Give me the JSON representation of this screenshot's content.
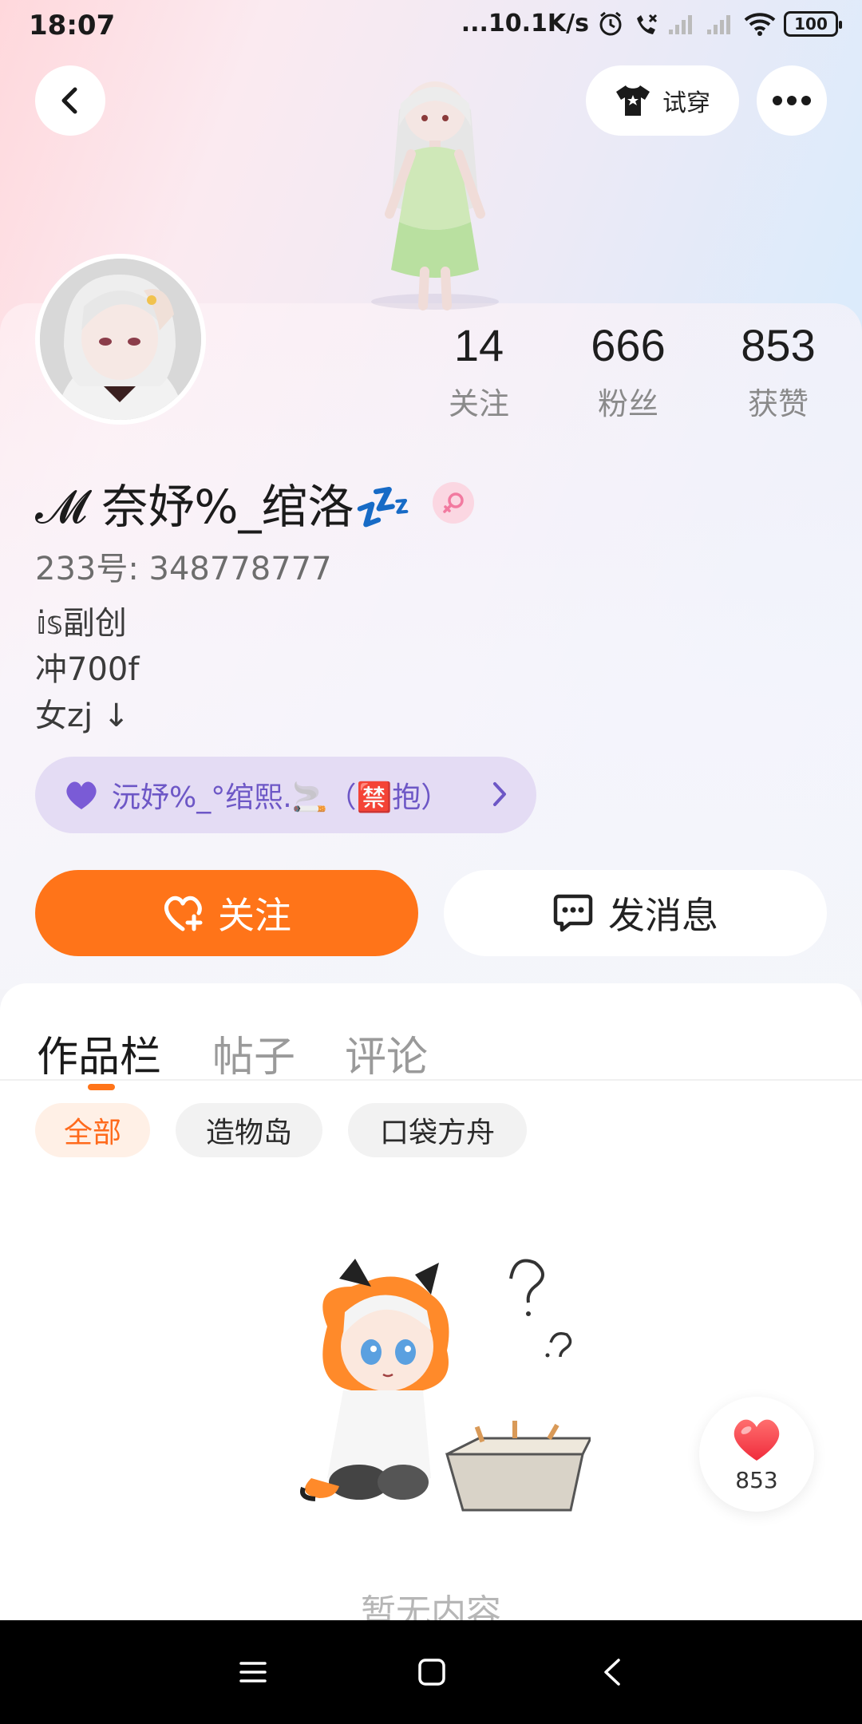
{
  "status_bar": {
    "time": "18:07",
    "net_speed": "...10.1K/s",
    "battery": "100"
  },
  "header": {
    "try_on_label": "试穿"
  },
  "profile": {
    "nickname": "𝓜 奈妤%_绾洛💤",
    "uid_line": "233号: 348778777",
    "bio_lines": [
      "𝕚𝕤副创",
      "冲700f",
      "女zj ↓"
    ],
    "relation_tag": "沅妤%_°绾熙.🚬（🈲抱）",
    "gender": "female-icon"
  },
  "stats": [
    {
      "value": "14",
      "label": "关注"
    },
    {
      "value": "666",
      "label": "粉丝"
    },
    {
      "value": "853",
      "label": "获赞"
    }
  ],
  "actions": {
    "follow_label": "关注",
    "message_label": "发消息"
  },
  "tabs": [
    {
      "label": "作品栏",
      "active": true
    },
    {
      "label": "帖子",
      "active": false
    },
    {
      "label": "评论",
      "active": false
    }
  ],
  "filters": [
    {
      "label": "全部",
      "active": true
    },
    {
      "label": "造物岛",
      "active": false
    },
    {
      "label": "口袋方舟",
      "active": false
    }
  ],
  "empty_state": {
    "text": "暂无内容"
  },
  "like_float": {
    "count": "853"
  },
  "colors": {
    "accent": "#ff7419",
    "relation_text": "#6d57c6"
  }
}
